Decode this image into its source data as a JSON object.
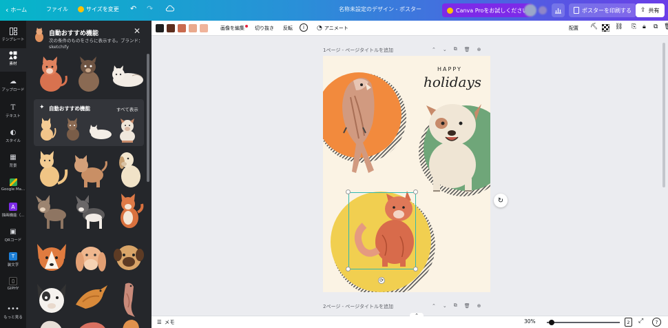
{
  "topbar": {
    "back_label": "ホーム",
    "file_label": "ファイル",
    "resize_label": "サイズを変更",
    "undo_icon": "undo-icon",
    "redo_icon": "redo-icon",
    "cloud_icon": "cloud-icon",
    "doc_title": "名称未設定のデザイン - ポスター",
    "pro_label": "Canva Proをお試しください",
    "print_label": "ポスターを印刷する",
    "share_label": "共有",
    "colors": {
      "gradient_start": "#05b6c9",
      "gradient_end": "#6a3ee8",
      "pro_btn": "#7d2ae8"
    }
  },
  "rail": {
    "items": [
      {
        "label": "テンプレート",
        "icon": "template-icon"
      },
      {
        "label": "素材",
        "icon": "elements-icon"
      },
      {
        "label": "アップロード",
        "icon": "upload-icon"
      },
      {
        "label": "テキスト",
        "icon": "text-icon"
      },
      {
        "label": "スタイル",
        "icon": "style-icon"
      },
      {
        "label": "背景",
        "icon": "background-icon"
      },
      {
        "label": "Google Ma...",
        "icon": "google-maps-icon"
      },
      {
        "label": "描画機能（...",
        "icon": "draw-icon"
      },
      {
        "label": "QRコード",
        "icon": "qr-icon"
      },
      {
        "label": "装文字",
        "icon": "fancy-text-icon"
      },
      {
        "label": "GIPHY",
        "icon": "giphy-icon"
      },
      {
        "label": "もっと見る",
        "icon": "more-icon"
      }
    ]
  },
  "panel": {
    "title": "自動おすすめ機能",
    "description": "次の条件のものをさらに表示する。ブランド：sketchify",
    "sub_title": "自動おすすめ機能",
    "see_all": "すべて表示",
    "close_icon": "close-icon"
  },
  "toolbar": {
    "swatches": [
      "#1f1f1f",
      "#5c2d1d",
      "#c96a4f",
      "#e9a98d",
      "#f0b49b"
    ],
    "edit_image": "画像を編集",
    "crop": "切り抜き",
    "flip": "反転",
    "animate": "アニメート",
    "arrange": "配置"
  },
  "canvas": {
    "page1_label": "1ページ - ページタイトルを追加",
    "page2_label": "2ページ - ページタイトルを追加",
    "poster_text_happy": "HAPPY",
    "poster_text_holidays": "holidays"
  },
  "bottombar": {
    "notes_label": "メモ",
    "zoom": "30%",
    "zoom_fraction": 0.3,
    "page_count": "2"
  }
}
